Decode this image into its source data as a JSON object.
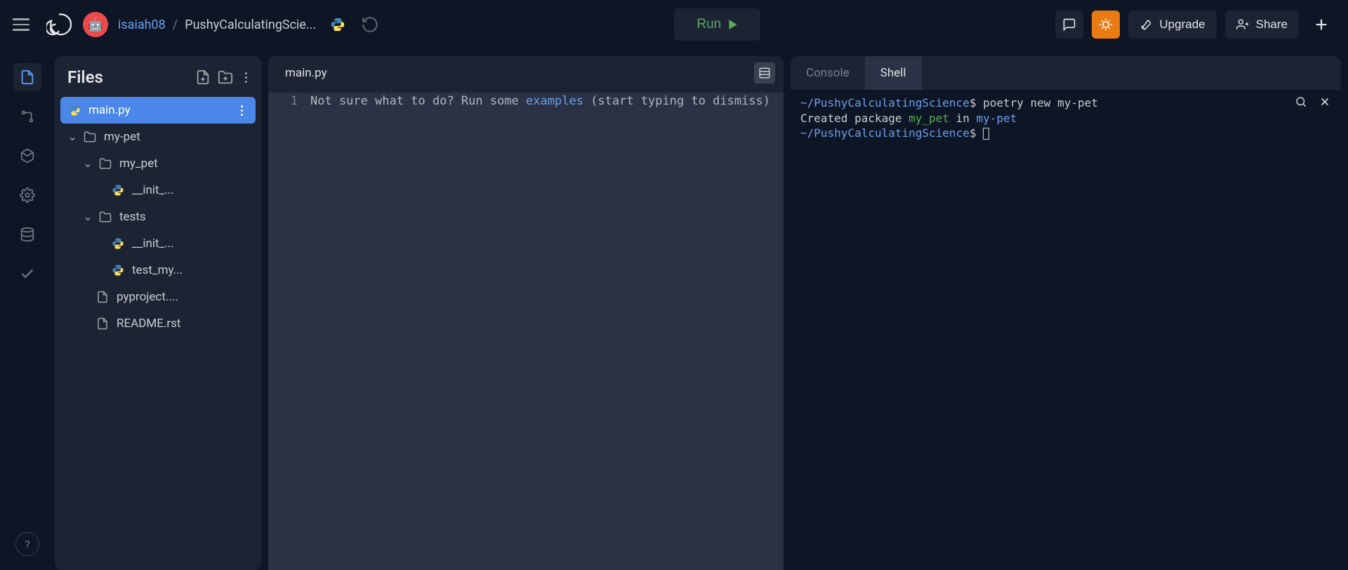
{
  "header": {
    "username": "isaiah08",
    "separator": "/",
    "project": "PushyCalculatingScie...",
    "run_label": "Run",
    "upgrade_label": "Upgrade",
    "share_label": "Share"
  },
  "files": {
    "title": "Files",
    "items": [
      {
        "name": "main.py",
        "type": "py",
        "indent": 0,
        "active": true,
        "expand": null
      },
      {
        "name": "my-pet",
        "type": "folder",
        "indent": 0,
        "active": false,
        "expand": "down"
      },
      {
        "name": "my_pet",
        "type": "folder",
        "indent": 1,
        "active": false,
        "expand": "down"
      },
      {
        "name": "__init_...",
        "type": "py",
        "indent": 2,
        "active": false,
        "expand": null
      },
      {
        "name": "tests",
        "type": "folder",
        "indent": 1,
        "active": false,
        "expand": "down"
      },
      {
        "name": "__init_...",
        "type": "py",
        "indent": 2,
        "active": false,
        "expand": null
      },
      {
        "name": "test_my...",
        "type": "py",
        "indent": 2,
        "active": false,
        "expand": null
      },
      {
        "name": "pyproject....",
        "type": "file",
        "indent": 1,
        "active": false,
        "expand": null
      },
      {
        "name": "README.rst",
        "type": "file",
        "indent": 1,
        "active": false,
        "expand": null
      }
    ]
  },
  "editor": {
    "tab_label": "main.py",
    "line_number": "1",
    "ghost_pre": "Not sure what to do? Run some ",
    "ghost_link": "examples",
    "ghost_post": " (start typing to dismiss)"
  },
  "console": {
    "tabs": {
      "console": "Console",
      "shell": "Shell"
    },
    "prompt_path": "~/PushyCalculatingScience",
    "prompt_symbol": "$",
    "cmd1": "poetry new my-pet",
    "out_pre": "Created package ",
    "out_pkg": "my_pet",
    "out_mid": " in ",
    "out_dir": "my-pet"
  }
}
